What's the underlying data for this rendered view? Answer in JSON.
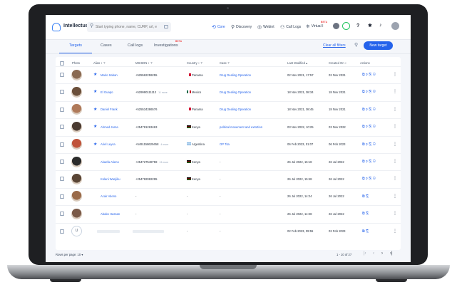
{
  "nav": {
    "brand": "Intellectus",
    "search_placeholder": "Start typing phone, name, CURP, url, e",
    "items": [
      {
        "label": "Core",
        "icon": "core-icon"
      },
      {
        "label": "Discovery",
        "icon": "discovery-icon"
      },
      {
        "label": "Webint",
        "icon": "webint-icon"
      },
      {
        "label": "Call Logs",
        "icon": "call-logs-icon"
      },
      {
        "label": "Virtual I",
        "icon": "virtual-id-icon",
        "badge": "BETA"
      }
    ],
    "help_icon": "?"
  },
  "tabs": [
    {
      "label": "Targets",
      "active": true
    },
    {
      "label": "Cases"
    },
    {
      "label": "Call logs"
    },
    {
      "label": "Investigations",
      "badge": "BETA"
    }
  ],
  "clear_filters": "Clear all filters",
  "new_target": "New target",
  "columns": [
    "Photo",
    "Alias",
    "MSISDN",
    "Country",
    "Case",
    "Last Modified",
    "Created On",
    "Actions"
  ],
  "rows": [
    {
      "alias": "Mario Saban",
      "starred": true,
      "msisdn": "+525562259255",
      "country": "Panama",
      "flag": "pa",
      "case": "Drug Dealing Operation",
      "modified": "02 Nov 2021, 17:57",
      "created": "02 Nov 2021",
      "avatar": "#8a6a52"
    },
    {
      "alias": "El Guapo",
      "starred": true,
      "msisdn": "+529990111112",
      "more": "11 more",
      "country": "Mexico",
      "flag": "mx",
      "case": "Drug Dealing Operation",
      "modified": "18 Nov 2021, 08:34",
      "created": "18 Nov 2021",
      "avatar": "#6b4f3a"
    },
    {
      "alias": "Daniel Frank",
      "starred": true,
      "msisdn": "+525534386576",
      "country": "Panama",
      "flag": "pa",
      "case": "Drug Dealing Operation",
      "modified": "18 Nov 2021, 08:45",
      "created": "18 Nov 2021",
      "avatar": "#b07a5a"
    },
    {
      "alias": "Ahmed Juma",
      "starred": true,
      "msisdn": "+254781263463",
      "country": "Kenya",
      "flag": "ke",
      "case": "political movement and extortion",
      "modified": "03 Nov 2022, 10:25",
      "created": "03 Nov 2022",
      "avatar": "#4a3a30"
    },
    {
      "alias": "Ariel Leyva",
      "starred": true,
      "msisdn": "+5491158629458",
      "more": "4 more",
      "country": "Argentina",
      "flag": "ar",
      "case": "OP Tita",
      "modified": "06 Feb 2023, 01:07",
      "created": "06 Feb 2023",
      "avatar": "#c0533a"
    },
    {
      "alias": "Akaefa Atieno",
      "starred": false,
      "msisdn": "+254727548759",
      "more": "13 more",
      "country": "Kenya",
      "flag": "ke",
      "case": "-",
      "modified": "26 Jul 2022, 15:18",
      "created": "26 Jul 2022",
      "avatar": "#2b2b2b"
    },
    {
      "alias": "Kolani Wanjiku",
      "starred": false,
      "msisdn": "+254782082295",
      "country": "Kenya",
      "flag": "ke",
      "case": "-",
      "modified": "26 Jul 2022, 15:48",
      "created": "26 Jul 2022",
      "avatar": "#5a4535"
    },
    {
      "alias": "Acair Atieno",
      "starred": false,
      "msisdn": "-",
      "country": "-",
      "flag": "",
      "case": "-",
      "modified": "26 Jul 2022, 14:24",
      "created": "26 Jul 2022",
      "avatar": "#9a6a48"
    },
    {
      "alias": "Abako Hassan",
      "starred": false,
      "msisdn": "-",
      "country": "-",
      "flag": "",
      "case": "-",
      "modified": "26 Jul 2022, 14:28",
      "created": "26 Jul 2022",
      "avatar": "#7a5a48"
    },
    {
      "alias": "",
      "starred": false,
      "msisdn": "",
      "country": "-",
      "flag": "",
      "case": "-",
      "modified": "02 Feb 2023, 09:55",
      "created": "02 Feb 2023",
      "avatar": "",
      "initial": "U"
    }
  ],
  "footer": {
    "rows_per_page_label": "Rows per page:",
    "rows_per_page_value": "10",
    "range": "1 - 10 of 27"
  },
  "colors": {
    "accent": "#2563eb",
    "beta": "#ef4444"
  }
}
